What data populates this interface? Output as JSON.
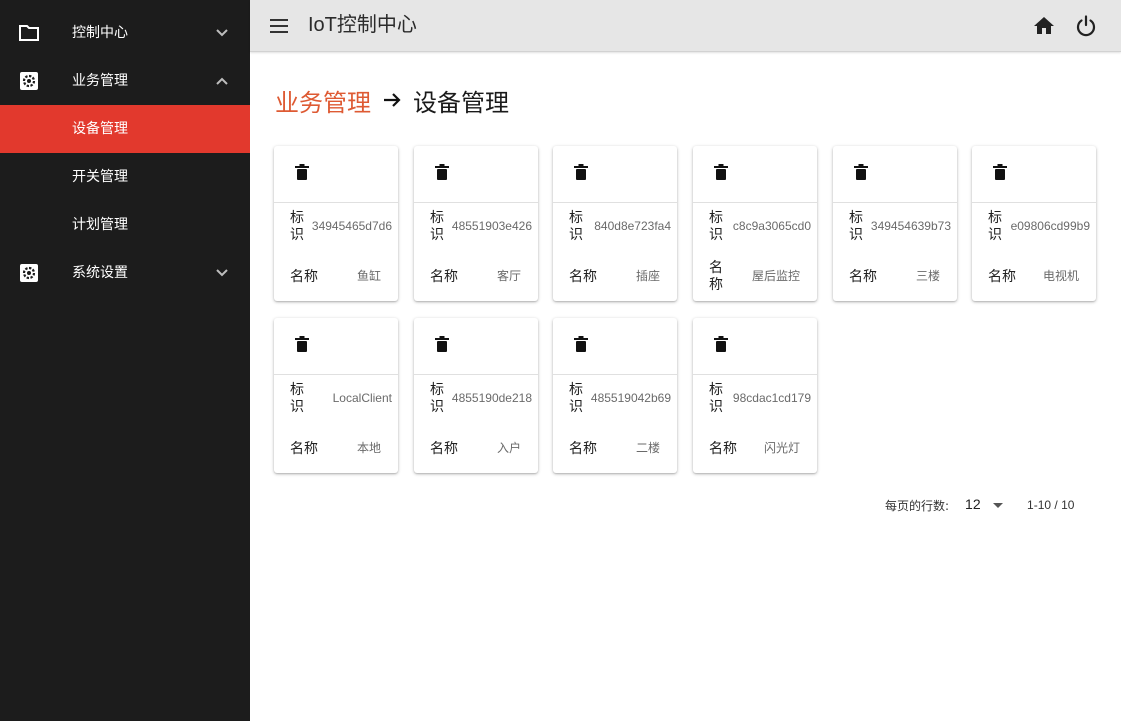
{
  "sidebar": {
    "items": [
      {
        "label": "控制中心",
        "icon": "folder-icon",
        "expanded": false
      },
      {
        "label": "业务管理",
        "icon": "gear-icon",
        "expanded": true
      },
      {
        "label": "设备管理",
        "active": true
      },
      {
        "label": "开关管理"
      },
      {
        "label": "计划管理"
      },
      {
        "label": "系统设置",
        "icon": "gear-icon",
        "expanded": false
      }
    ],
    "bg_color": "#1c1c1c",
    "active_color": "#e2392d"
  },
  "header": {
    "title": "IoT控制中心",
    "icons": [
      "menu-icon",
      "home-icon",
      "power-icon"
    ]
  },
  "breadcrumb": {
    "parent": "业务管理",
    "current": "设备管理",
    "parent_color": "#de5a33"
  },
  "cards": {
    "id_label": "标识",
    "name_label": "名称",
    "delete_icon": "trash-icon",
    "items": [
      {
        "id": "34945465d7d6",
        "name": "鱼缸"
      },
      {
        "id": "48551903e426",
        "name": "客厅"
      },
      {
        "id": "840d8e723fa4",
        "name": "插座"
      },
      {
        "id": "c8c9a3065cd0",
        "name": "屋后监控"
      },
      {
        "id": "349454639b73",
        "name": "三楼"
      },
      {
        "id": "e09806cd99b9",
        "name": "电视机"
      },
      {
        "id": "LocalClient",
        "name": "本地"
      },
      {
        "id": "4855190de218",
        "name": "入户"
      },
      {
        "id": "485519042b69",
        "name": "二楼"
      },
      {
        "id": "98cdac1cd179",
        "name": "闪光灯"
      }
    ]
  },
  "pagination": {
    "rows_label": "每页的行数:",
    "rows_value": "12",
    "range": "1-10 / 10"
  }
}
